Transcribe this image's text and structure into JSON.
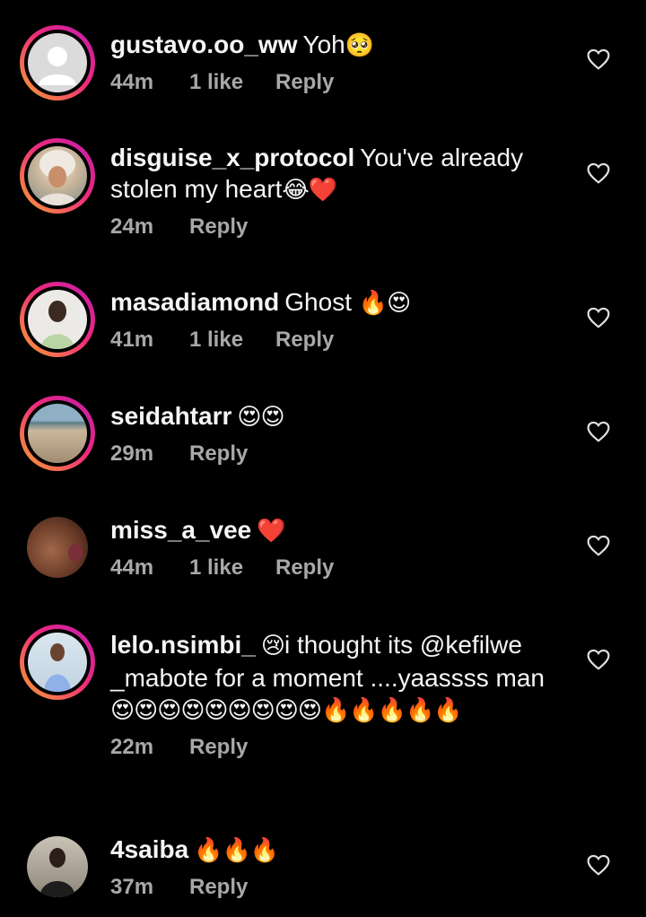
{
  "comments": [
    {
      "username": "gustavo.oo_ww",
      "text": "Yoh",
      "emoji": "🥺",
      "time": "44m",
      "likes": "1 like",
      "reply": "Reply",
      "avatar": "default-avatar"
    },
    {
      "username": "disguise_x_protocol",
      "text": "You've already stolen my heart",
      "emoji": "😂❤️",
      "time": "24m",
      "likes": "",
      "reply": "Reply",
      "avatar": "photo"
    },
    {
      "username": "masadiamond",
      "text": "Ghost ",
      "emoji": "🔥😍",
      "time": "41m",
      "likes": "1 like",
      "reply": "Reply",
      "avatar": "photo"
    },
    {
      "username": "seidahtarr",
      "text": "",
      "emoji": "😍😍",
      "time": "29m",
      "likes": "",
      "reply": "Reply",
      "avatar": "beach-photo"
    },
    {
      "username": "miss_a_vee",
      "text": "",
      "emoji": "❤️",
      "time": "44m",
      "likes": "1 like",
      "reply": "Reply",
      "avatar": "photo"
    },
    {
      "username": "lelo.nsimbi_",
      "text_parts": [
        "😢",
        "i thought its @kefilwe _mabote  for a moment ....yaassss man",
        "😍😍😍😍😍😍😍😍😍🔥🔥🔥🔥🔥"
      ],
      "time": "22m",
      "likes": "",
      "reply": "Reply",
      "avatar": "photo"
    },
    {
      "username": "4saiba",
      "text": "",
      "emoji": "🔥🔥🔥",
      "time": "37m",
      "likes": "",
      "reply": "Reply",
      "avatar": "photo"
    }
  ],
  "colors": {
    "background": "#000000",
    "text": "#f5f5f5",
    "meta": "#a8a8a8",
    "ring_start": "#f9a431",
    "ring_end": "#c01cb0"
  }
}
